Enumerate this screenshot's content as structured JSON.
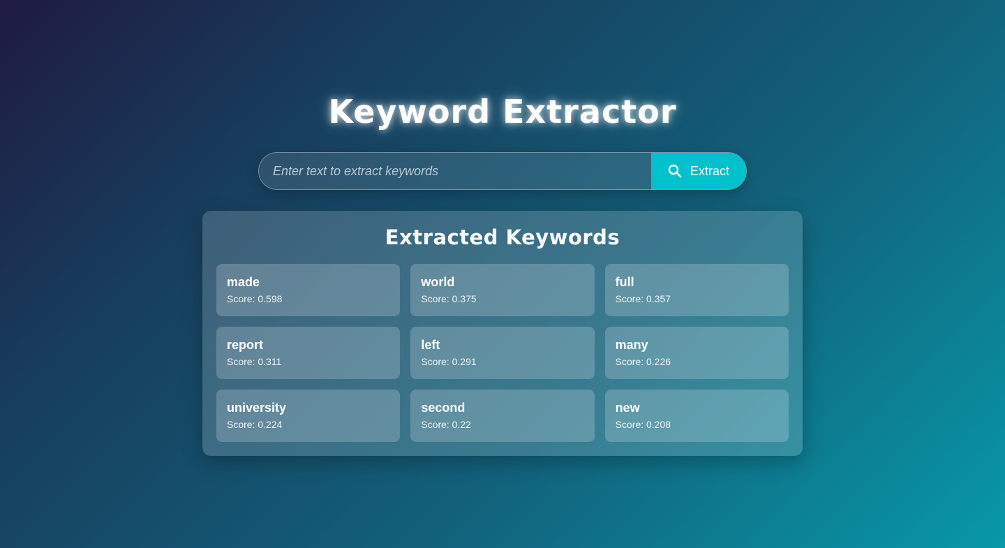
{
  "header": {
    "title": "Keyword Extractor"
  },
  "search": {
    "placeholder": "Enter text to extract keywords",
    "value": "",
    "button_label": "Extract",
    "button_icon": "search-icon"
  },
  "results": {
    "title": "Extracted Keywords",
    "score_prefix": "Score: ",
    "keywords": [
      {
        "word": "made",
        "score": "Score: 0.598"
      },
      {
        "word": "world",
        "score": "Score: 0.375"
      },
      {
        "word": "full",
        "score": "Score: 0.357"
      },
      {
        "word": "report",
        "score": "Score: 0.311"
      },
      {
        "word": "left",
        "score": "Score: 0.291"
      },
      {
        "word": "many",
        "score": "Score: 0.226"
      },
      {
        "word": "university",
        "score": "Score: 0.224"
      },
      {
        "word": "second",
        "score": "Score: 0.22"
      },
      {
        "word": "new",
        "score": "Score: 0.208"
      }
    ]
  },
  "colors": {
    "accent": "#00c1cc",
    "background_start": "#1f1a42",
    "background_end": "#0898a8"
  }
}
